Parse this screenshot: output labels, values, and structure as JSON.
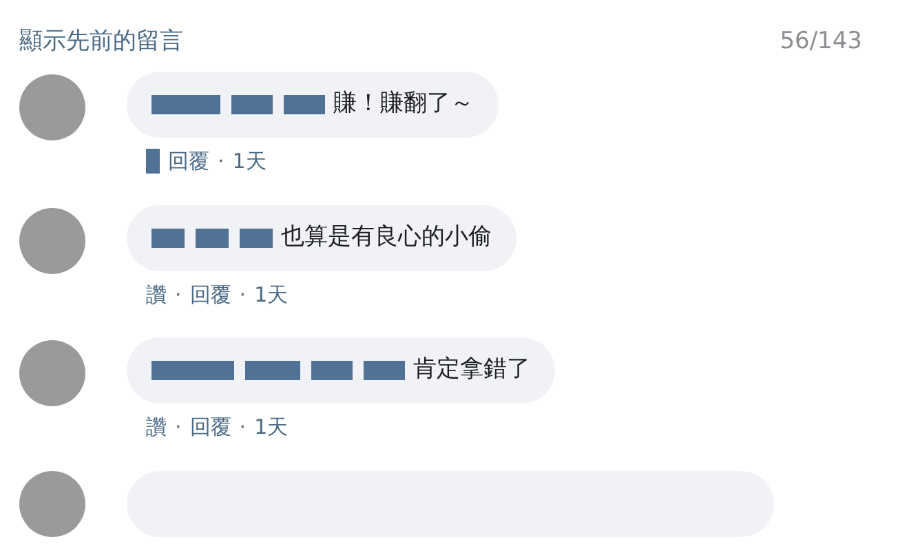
{
  "header": {
    "title": "顯示先前的留言",
    "count": "56/143"
  },
  "comments": [
    {
      "text": "賺！賺翻了～",
      "actions": [
        {
          "kind": "redacted"
        },
        {
          "kind": "text",
          "text": "回覆"
        },
        {
          "kind": "separator",
          "text": "·"
        },
        {
          "kind": "text",
          "text": "1天"
        }
      ]
    },
    {
      "text": "也算是有良心的小偷",
      "actions": [
        {
          "kind": "text",
          "text": "讚"
        },
        {
          "kind": "separator",
          "text": "·"
        },
        {
          "kind": "text",
          "text": "回覆"
        },
        {
          "kind": "separator",
          "text": "·"
        },
        {
          "kind": "text",
          "text": "1天"
        }
      ]
    },
    {
      "text": "肯定拿錯了",
      "actions": [
        {
          "kind": "text",
          "text": "讚"
        },
        {
          "kind": "separator",
          "text": "·"
        },
        {
          "kind": "text",
          "text": "回覆"
        },
        {
          "kind": "separator",
          "text": "·"
        },
        {
          "kind": "text",
          "text": "1天"
        }
      ]
    }
  ]
}
